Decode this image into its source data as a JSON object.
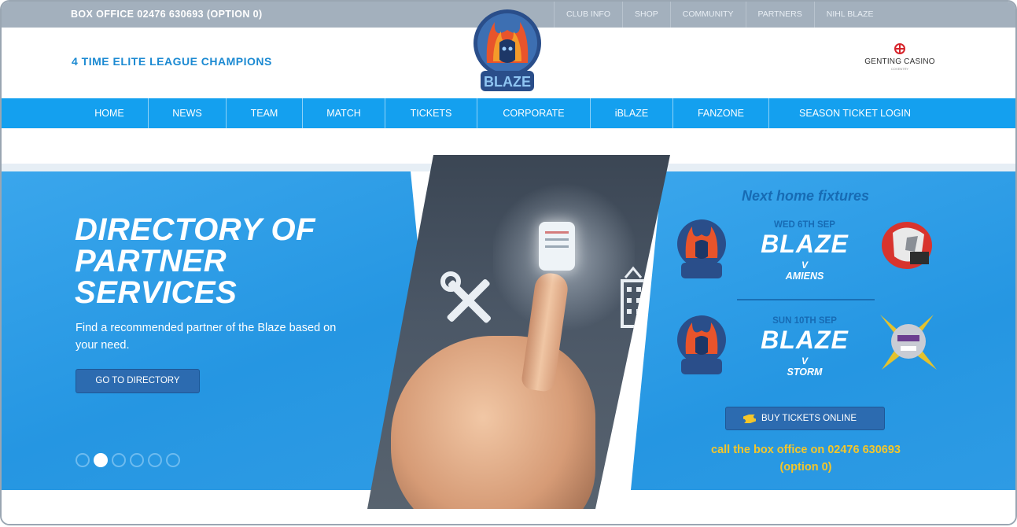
{
  "topbar": {
    "box_office": "BOX OFFICE 02476 630693 (OPTION 0)",
    "links": [
      "CLUB INFO",
      "SHOP",
      "COMMUNITY",
      "PARTNERS",
      "NIHL BLAZE"
    ]
  },
  "header": {
    "logo_text": "BLAZE",
    "tagline": "4 TIME ELITE LEAGUE CHAMPIONS",
    "sponsor_name": "GENTING CASINO",
    "sponsor_sub": "COVENTRY"
  },
  "nav": {
    "items": [
      "HOME",
      "NEWS",
      "TEAM",
      "MATCH",
      "TICKETS",
      "CORPORATE",
      "iBLAZE",
      "FANZONE",
      "SEASON TICKET LOGIN"
    ]
  },
  "promo": {
    "title_lines": [
      "DIRECTORY OF",
      "PARTNER",
      "SERVICES"
    ],
    "text": "Find a recommended partner of the Blaze based on your need.",
    "button": "GO TO DIRECTORY",
    "slide_count": 6,
    "active_slide": 2
  },
  "fixtures": {
    "title": "Next home fixtures",
    "items": [
      {
        "date": "WED 6TH SEP",
        "home": "BLAZE",
        "vs": "V",
        "away": "AMIENS"
      },
      {
        "date": "SUN 10TH SEP",
        "home": "BLAZE",
        "vs": "V",
        "away": "STORM"
      }
    ],
    "buy_button": "BUY TICKETS ONLINE",
    "call_line1": "call the box office on 02476 630693",
    "call_line2": "(option 0)"
  },
  "colors": {
    "topbar": "#a3b0bd",
    "nav": "#14a0ef",
    "panel": "#2596e2",
    "button": "#2c6bb0",
    "highlight": "#f4c62a",
    "accent_text": "#176bb4"
  },
  "icons": [
    "blaze-logo-icon",
    "genting-casino-icon",
    "tools-icon",
    "building-icon",
    "ticket-icon",
    "amiens-logo-icon",
    "storm-logo-icon"
  ]
}
